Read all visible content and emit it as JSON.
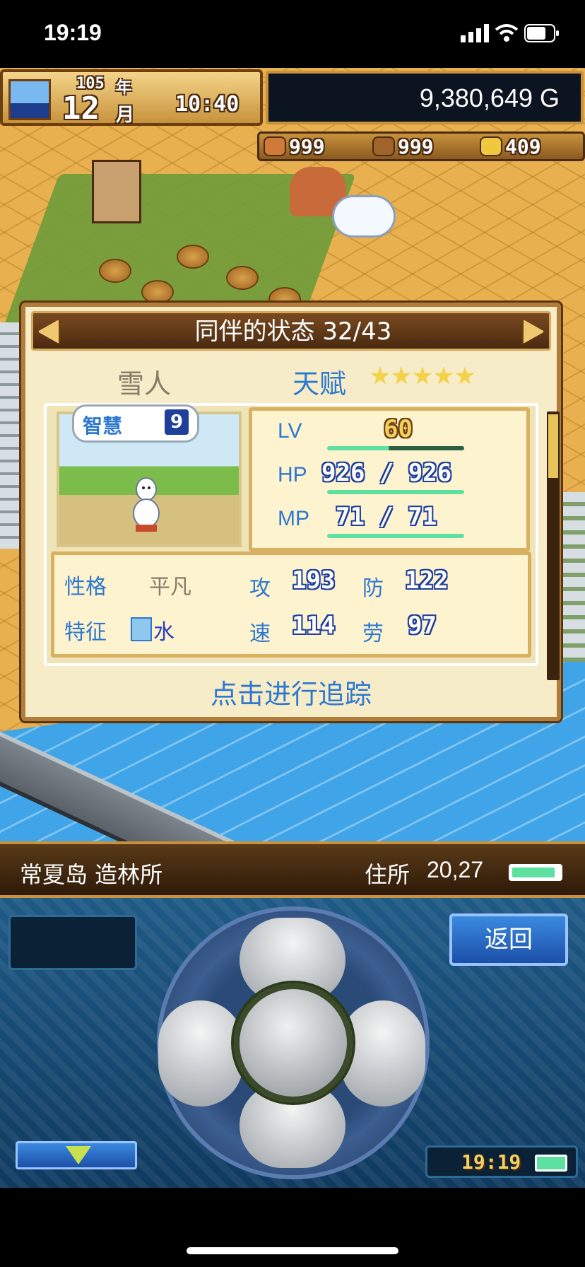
{
  "status_bar": {
    "time": "19:19"
  },
  "hud": {
    "year": "105",
    "year_unit": "年",
    "month": "12",
    "month_unit": "月",
    "clock": "10:40",
    "money": "9,380,649 G",
    "resources": [
      {
        "icon": "meat-icon",
        "value": "999",
        "color": "#d07a3a"
      },
      {
        "icon": "wood-icon",
        "value": "999",
        "color": "#a0642a"
      },
      {
        "icon": "gold-icon",
        "value": "409",
        "color": "#f0c840"
      }
    ]
  },
  "panel": {
    "title": "同伴的状态 32/43",
    "name": "雪人",
    "talent_label": "天赋",
    "talent_stars": 5,
    "bubble": {
      "label": "智慧",
      "value": "9"
    },
    "stats": {
      "lv_label": "LV",
      "lv": "60",
      "hp_label": "HP",
      "hp": "926 / 926",
      "mp_label": "MP",
      "mp": "71 / 71"
    },
    "traits": {
      "personality_label": "性格",
      "personality": "平凡",
      "feature_label": "特征",
      "feature": "水",
      "atk_label": "攻",
      "atk": "193",
      "def_label": "防",
      "def": "122",
      "spd_label": "速",
      "spd": "114",
      "labor_label": "劳",
      "labor": "97"
    },
    "track_button": "点击进行追踪"
  },
  "location": {
    "name": "常夏岛 造林所",
    "address_label": "住所",
    "address": "20,27"
  },
  "controller": {
    "back_label": "返回",
    "clock": "19:19"
  }
}
